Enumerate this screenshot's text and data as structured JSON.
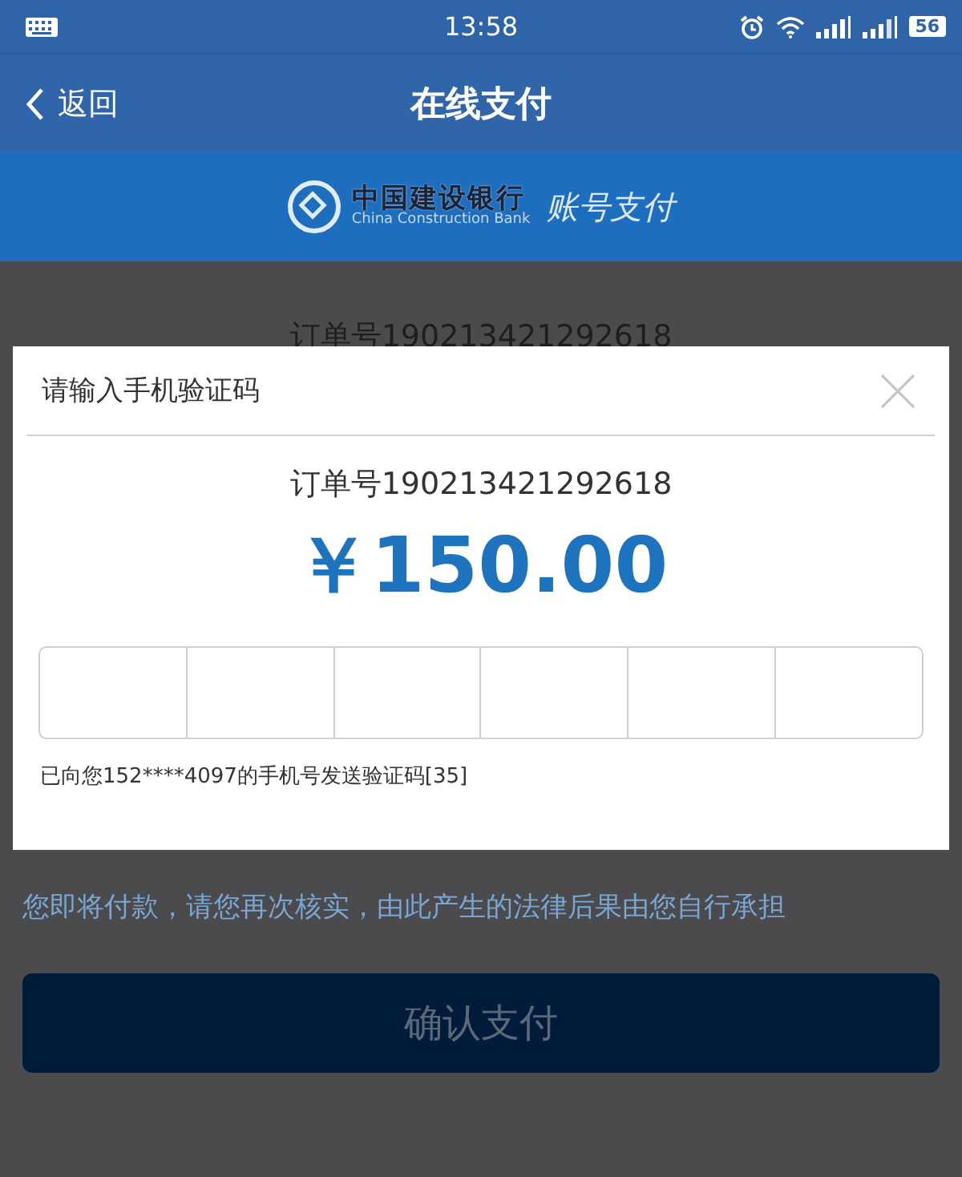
{
  "status_bar": {
    "time": "13:58",
    "battery": "56"
  },
  "header": {
    "back": "返回",
    "title": "在线支付"
  },
  "banner": {
    "bank_name": "中国建设银行",
    "bank_name_en": "China Construction Bank",
    "method": "账号支付"
  },
  "page": {
    "order": "订单号190213421292618",
    "warning": "您即将付款，请您再次核实，由此产生的法律后果由您自行承担",
    "confirm_button": "确认支付"
  },
  "dialog": {
    "title": "请输入手机验证码",
    "order": "订单号190213421292618",
    "amount": "￥150.00",
    "hint": "已向您152****4097的手机号发送验证码[35]"
  }
}
